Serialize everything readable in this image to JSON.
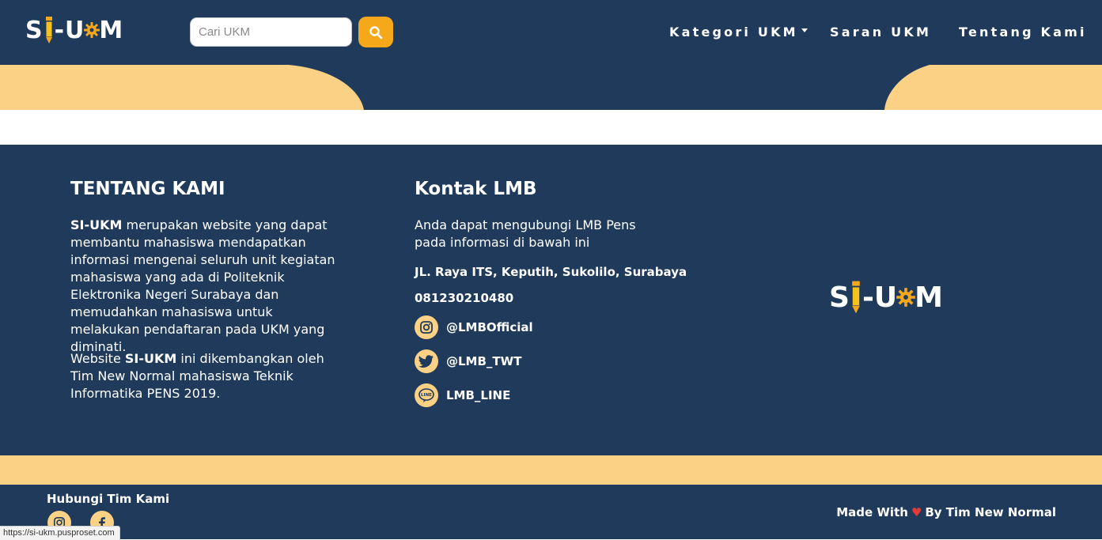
{
  "colors": {
    "navy": "#1f3a5a",
    "cream": "#fbd185",
    "orange": "#f6a81b",
    "heart": "#e53935"
  },
  "navbar": {
    "logo_parts": [
      "S",
      "-U",
      "M"
    ],
    "search_placeholder": "Cari UKM",
    "search_icon": "search-icon",
    "items": [
      {
        "label": "Kategori UKM",
        "has_dropdown": true
      },
      {
        "label": "Saran UKM"
      },
      {
        "label": "Tentang Kami"
      }
    ]
  },
  "about": {
    "title": "TENTANG KAMI",
    "p1_bold": "SI-UKM",
    "p1_rest": " merupakan website yang dapat membantu mahasiswa mendapatkan informasi mengenai seluruh unit kegiatan mahasiswa yang ada di Politeknik Elektronika Negeri Surabaya dan memudahkan mahasiswa untuk melakukan pendaftaran pada UKM yang diminati.",
    "p2_start": "Website ",
    "p2_bold": "SI-UKM",
    "p2_rest": " ini dikembangkan oleh Tim New Normal mahasiswa Teknik Informatika PENS 2019."
  },
  "contact": {
    "title": "Kontak LMB",
    "intro": "Anda dapat mengubungi LMB Pens pada informasi di bawah ini",
    "address": "JL. Raya ITS, Keputih, Sukolilo, Surabaya",
    "phone": "081230210480",
    "socials": [
      {
        "icon": "instagram-icon",
        "label": "@LMBOfficial"
      },
      {
        "icon": "twitter-icon",
        "label": "@LMB_TWT"
      },
      {
        "icon": "line-icon",
        "label": "LMB_LINE"
      }
    ]
  },
  "bottom": {
    "hub_title": "Hubungi Tim Kami",
    "made_pre": "Made With",
    "made_post": "By Tim New Normal"
  },
  "status_url": "https://si-ukm.pusproset.com"
}
